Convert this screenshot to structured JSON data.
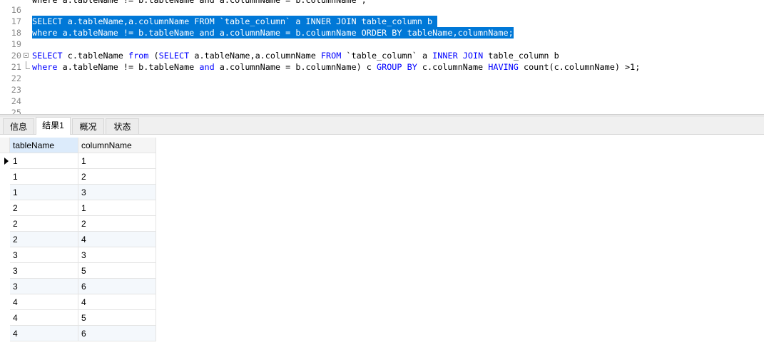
{
  "editor": {
    "top_partial": "where a.tableName != b.tableName and a.columnName = b.columnName ;",
    "line_numbers": [
      "16",
      "17",
      "18",
      "19",
      "20",
      "21",
      "22",
      "23",
      "24",
      "25"
    ],
    "line17": "SELECT a.tableName,a.columnName FROM `table_column` a INNER JOIN table_column b ",
    "line18": "where a.tableName != b.tableName and a.columnName = b.columnName ORDER BY tableName,columnName;",
    "line20": {
      "t1": "SELECT",
      "t2": " c.tableName ",
      "t3": "from",
      "t4": " (",
      "t5": "SELECT",
      "t6": " a.tableName,a.columnName ",
      "t7": "FROM",
      "t8": " `table_column` a ",
      "t9": "INNER JOIN",
      "t10": " table_column b"
    },
    "line21": {
      "t1": "where",
      "t2": " a.tableName != b.tableName ",
      "t3": "and",
      "t4": " a.columnName = b.columnName) c ",
      "t5": "GROUP BY",
      "t6": " c.columnName ",
      "t7": "HAVING",
      "t8": " count(c.columnName) >1;"
    }
  },
  "tabs": [
    "信息",
    "结果1",
    "概况",
    "状态"
  ],
  "active_tab": "结果1",
  "grid": {
    "columns": [
      "tableName",
      "columnName"
    ],
    "rows": [
      [
        "1",
        "1"
      ],
      [
        "1",
        "2"
      ],
      [
        "1",
        "3"
      ],
      [
        "2",
        "1"
      ],
      [
        "2",
        "2"
      ],
      [
        "2",
        "4"
      ],
      [
        "3",
        "3"
      ],
      [
        "3",
        "5"
      ],
      [
        "3",
        "6"
      ],
      [
        "4",
        "4"
      ],
      [
        "4",
        "5"
      ],
      [
        "4",
        "6"
      ]
    ]
  },
  "colors": {
    "keyword": "#0000ff",
    "selection": "#0078d7",
    "sorted_header": "#dcebfb"
  }
}
